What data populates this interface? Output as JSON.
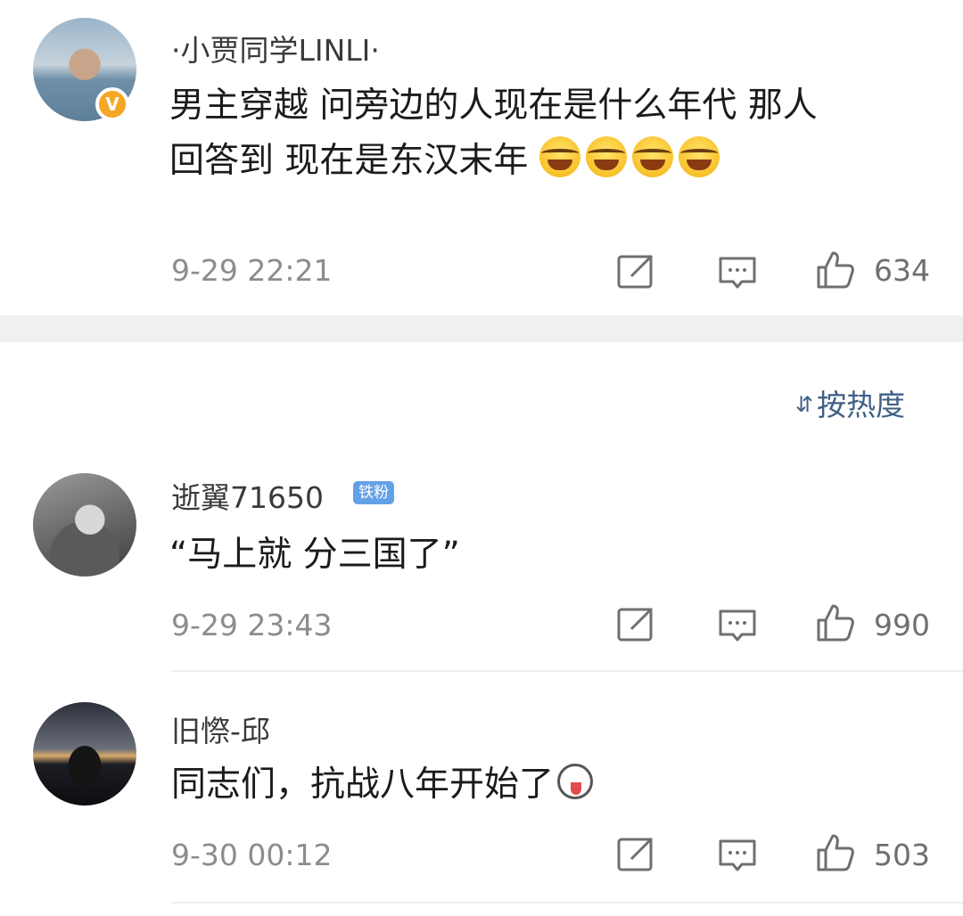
{
  "post": {
    "username": "·小贾同学LINLI·",
    "verified_badge": "V",
    "text_line1": "男主穿越 问旁边的人现在是什么年代 那人",
    "text_line2": "回答到 现在是东汉末年",
    "emoji": "laughing-tears-emoji",
    "timestamp": "9-29 22:21",
    "likes": "634"
  },
  "sort": {
    "label": "按热度",
    "icon": "sort-icon"
  },
  "comments": [
    {
      "username": "逝翼71650",
      "badge": "铁粉",
      "text": "“马上就 分三国了”",
      "timestamp": "9-29 23:43",
      "likes": "990"
    },
    {
      "username": "旧憏-邱",
      "text": "同志们，抗战八年开始了",
      "emoji": "dog-emoji",
      "timestamp": "9-30 00:12",
      "likes": "503"
    }
  ],
  "colors": {
    "link_blue": "#3e5f86",
    "badge_blue": "#62a1e6",
    "verified_orange": "#f5a623",
    "gray_text": "#8c8c8c"
  }
}
